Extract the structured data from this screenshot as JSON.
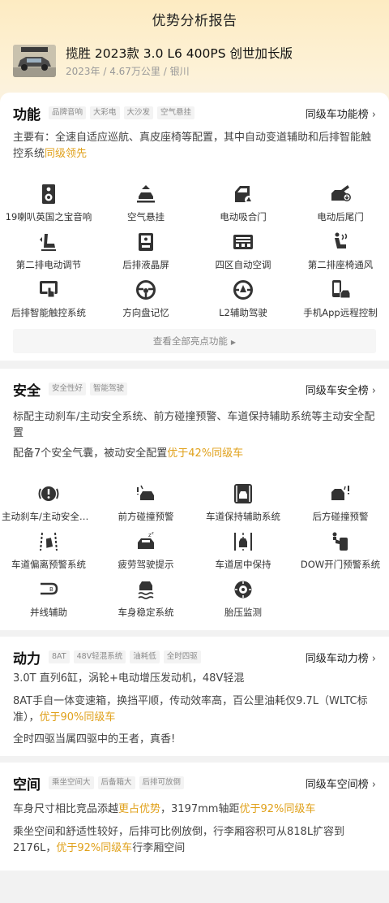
{
  "page_title": "优势分析报告",
  "car": {
    "name": "揽胜 2023款 3.0 L6 400PS 创世加长版",
    "meta": "2023年 / 4.67万公里 / 银川",
    "thumb_caption": "揽胜"
  },
  "sections": {
    "features": {
      "title": "功能",
      "tags": [
        "品牌音响",
        "大彩电",
        "大沙发",
        "空气悬挂"
      ],
      "rank_label": "同级车功能榜",
      "desc_main": "主要有：全速自适应巡航、真皮座椅等配置，其中自动变道辅助和后排智能触控系统",
      "desc_hl": "同级领先",
      "items": [
        {
          "label": "19喇叭英国之宝音响",
          "icon": "speaker-icon"
        },
        {
          "label": "空气悬挂",
          "icon": "air-suspension-icon"
        },
        {
          "label": "电动吸合门",
          "icon": "soft-close-door-icon"
        },
        {
          "label": "电动后尾门",
          "icon": "power-tailgate-icon"
        },
        {
          "label": "第二排电动调节",
          "icon": "power-seat-icon"
        },
        {
          "label": "后排液晶屏",
          "icon": "rear-screen-icon"
        },
        {
          "label": "四区自动空调",
          "icon": "climate-icon"
        },
        {
          "label": "第二排座椅通风",
          "icon": "seat-ventilation-icon"
        },
        {
          "label": "后排智能触控系统",
          "icon": "touch-control-icon"
        },
        {
          "label": "方向盘记忆",
          "icon": "steering-memory-icon"
        },
        {
          "label": "L2辅助驾驶",
          "icon": "assisted-driving-icon"
        },
        {
          "label": "手机App远程控制",
          "icon": "phone-app-icon"
        }
      ],
      "view_all": "查看全部亮点功能"
    },
    "safety": {
      "title": "安全",
      "tags": [
        "安全性好",
        "智能驾驶"
      ],
      "rank_label": "同级车安全榜",
      "desc1": "标配主动刹车/主动安全系统、前方碰撞预警、车道保持辅助系统等主动安全配置",
      "desc2_main": "配备7个安全气囊，被动安全配置",
      "desc2_hl": "优于42%同级车",
      "items": [
        {
          "label": "主动刹车/主动安全系统",
          "icon": "active-brake-icon"
        },
        {
          "label": "前方碰撞预警",
          "icon": "front-collision-icon"
        },
        {
          "label": "车道保持辅助系统",
          "icon": "lane-keep-icon"
        },
        {
          "label": "后方碰撞预警",
          "icon": "rear-collision-icon"
        },
        {
          "label": "车道偏离预警系统",
          "icon": "lane-departure-icon"
        },
        {
          "label": "疲劳驾驶提示",
          "icon": "fatigue-icon"
        },
        {
          "label": "车道居中保持",
          "icon": "lane-center-icon"
        },
        {
          "label": "DOW开门预警系统",
          "icon": "dow-icon"
        },
        {
          "label": "并线辅助",
          "icon": "blind-spot-icon"
        },
        {
          "label": "车身稳定系统",
          "icon": "stability-icon"
        },
        {
          "label": "胎压监测",
          "icon": "tire-pressure-icon"
        }
      ]
    },
    "power": {
      "title": "动力",
      "tags": [
        "8AT",
        "48V轻混系统",
        "油耗低",
        "全时四驱"
      ],
      "rank_label": "同级车动力榜",
      "desc1": "3.0T 直列6缸，涡轮+电动增压发动机，48V轻混",
      "desc2_main": "8AT手自一体变速箱，换挡平顺，传动效率高，百公里油耗仅9.7L（WLTC标准），",
      "desc2_hl": "优于90%同级车",
      "desc3": "全时四驱当属四驱中的王者，真香!"
    },
    "space": {
      "title": "空间",
      "tags": [
        "乘坐空间大",
        "后备箱大",
        "后排可放倒"
      ],
      "rank_label": "同级车空间榜",
      "desc1_a": "车身尺寸相比竞品添越",
      "desc1_hl1": "更占优势",
      "desc1_b": "，3197mm轴距",
      "desc1_hl2": "优于92%同级车",
      "desc2_a": "乘坐空间和舒适性较好，后排可比例放倒，行李厢容积可从818L扩容到2176L，",
      "desc2_hl": "优于92%同级车",
      "desc2_b": "行李厢空间"
    }
  },
  "colors": {
    "highlight": "#e0a11b",
    "header_gradient_top": "#fdebc2",
    "text_primary": "#111111"
  }
}
